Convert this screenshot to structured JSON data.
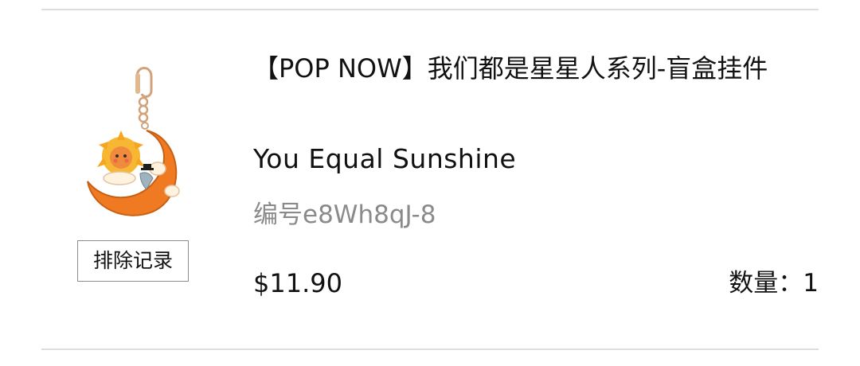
{
  "product": {
    "title": "【POP NOW】我们都是星星人系列-盲盒挂件",
    "variant": "You Equal Sunshine",
    "sku": "编号e8Wh8qJ-8",
    "price": "$11.90",
    "quantity_label": "数量：",
    "quantity_value": "1",
    "image_icon": "moon-sun-keychain-image"
  },
  "actions": {
    "exclude_label": "排除记录"
  },
  "colors": {
    "accent_orange": "#f07a22",
    "divider": "#dddddd",
    "muted_text": "#8a8a8a"
  }
}
